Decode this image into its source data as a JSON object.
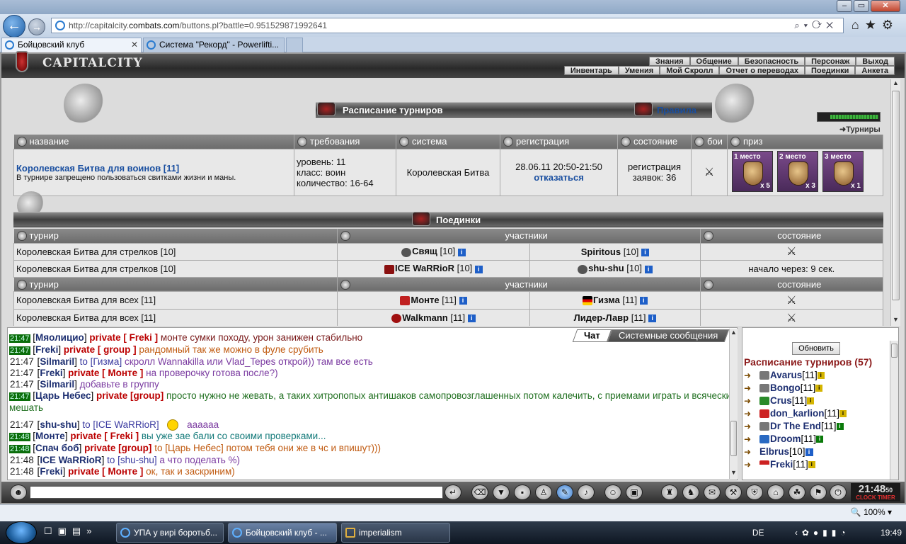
{
  "browser": {
    "url_prefix": "http://capitalcity.",
    "url_domain": "combats.com",
    "url_rest": "/buttons.pl?battle=0.951529871992641",
    "tabs": [
      {
        "label": "Бойцовский клуб"
      },
      {
        "label": "Система \"Рекорд\" - Powerlifti..."
      }
    ],
    "zoom": "100%"
  },
  "game": {
    "logo": "CAPITALCITY",
    "menu_row1": [
      "Знания",
      "Общение",
      "Безопасность",
      "Персонаж",
      "Выход"
    ],
    "menu_row2": [
      "Инвентарь",
      "Умения",
      "Мой Скролл",
      "Отчет о переводах",
      "Поединки",
      "Анкета"
    ],
    "turniry_link": "Турниры",
    "schedule": {
      "title": "Расписание турниров",
      "rules_link": "Правила",
      "headers": [
        "название",
        "требования",
        "система",
        "регистрация",
        "состояние",
        "бои",
        "приз"
      ],
      "row": {
        "name": "Королевская Битва для воинов [11]",
        "note": "В турнире запрещено пользоваться свитками жизни и маны.",
        "req_level": "уровень: 11",
        "req_class": "класс: воин",
        "req_count": "количество: 16-64",
        "system": "Королевская Битва",
        "reg_time": "28.06.11 20:50-21:50",
        "reg_cancel": "отказаться",
        "state_line1": "регистрация",
        "state_line2": "заявок: 36",
        "prizes": [
          {
            "place": "1 место",
            "qty": "x 5"
          },
          {
            "place": "2 место",
            "qty": "x 3"
          },
          {
            "place": "3 место",
            "qty": "x 1"
          }
        ]
      }
    },
    "fights": {
      "title": "Поединки",
      "header_tour": "турнир",
      "header_participants": "участники",
      "header_state": "состояние",
      "group1": [
        {
          "tour": "Королевская Битва для стрелков [10]",
          "p1": "Свящ",
          "p1lvl": " [10]",
          "p2": "Spiritous",
          "p2lvl": " [10]",
          "state": ""
        },
        {
          "tour": "Королевская Битва для стрелков [10]",
          "p1": "ICE WaRRioR",
          "p1lvl": " [10]",
          "p2": "shu-shu",
          "p2lvl": " [10]",
          "state": "начало через: 9 сек."
        }
      ],
      "group2": [
        {
          "tour": "Королевская Битва для всех [11]",
          "p1": "Монте",
          "p1lvl": " [11]",
          "p2": "Гизма",
          "p2lvl": " [11]",
          "state": ""
        },
        {
          "tour": "Королевская Битва для всех [11]",
          "p1": "Walkmann",
          "p1lvl": " [11]",
          "p2": "Лидер-Лавр",
          "p2lvl": " [11]",
          "state": ""
        }
      ]
    },
    "chat": {
      "tab_chat": "Чат",
      "tab_system": "Системные сообщения",
      "lines": [
        {
          "time": "21:47",
          "nick": "Мяолицио",
          "priv": "private [ Freki ]",
          "text": "монте сумки походу, урон занижен стабильно"
        },
        {
          "time": "21:47",
          "nick": "Freki",
          "priv": "private [ group ]",
          "text": "рандомный так же можно в фуле срубить"
        },
        {
          "time": "21:47",
          "nick": "Silmaril",
          "priv": "",
          "to": "to [Гизма]",
          "text": "скролл Wannakilla или Vlad_Tepes открой)) там все есть"
        },
        {
          "time": "21:47",
          "nick": "Freki",
          "priv": "private [ Монте ]",
          "text": "на проверочку готова после?)"
        },
        {
          "time": "21:47",
          "nick": "Silmaril",
          "priv": "",
          "text": "добавьте в группу"
        },
        {
          "time": "21:47",
          "nick": "Царь Небес",
          "priv": "private [group]",
          "text": "просто нужно не жевать, а таких хитропопых антишаков самопровозглашенных потом калечить, с приемами играть и всячески мешать"
        },
        {
          "time": "21:47",
          "nick": "shu-shu",
          "priv": "",
          "to": "to [ICE WaRRioR]",
          "text": "аааааа"
        },
        {
          "time": "21:48",
          "nick": "Монте",
          "priv": "private [ Freki ]",
          "text": "вы уже зае бали со своими проверками..."
        },
        {
          "time": "21:48",
          "nick": "Спач боб",
          "priv": "private [group]",
          "text": "to [Царь Небес] потом тебя они же в чс и впишут)))"
        },
        {
          "time": "21:48",
          "nick": "ICE WaRRioR",
          "priv": "",
          "to": "to [shu-shu]",
          "text": "а что поделать %)"
        },
        {
          "time": "21:48",
          "nick": "Freki",
          "priv": "private [ Монте ]",
          "text": "ок, так и заскриним)"
        }
      ]
    },
    "sidebar": {
      "refresh": "Обновить",
      "title": "Расписание турниров (57)",
      "players": [
        {
          "name": "Avarus",
          "lvl": "[11]"
        },
        {
          "name": "Bongo",
          "lvl": "[11]"
        },
        {
          "name": "Crus",
          "lvl": "[11]"
        },
        {
          "name": "don_karlion",
          "lvl": "[11]"
        },
        {
          "name": "Dr The End",
          "lvl": "[11]"
        },
        {
          "name": "Droom",
          "lvl": "[11]"
        },
        {
          "name": "Elbrus",
          "lvl": "[10]"
        },
        {
          "name": "Freki",
          "lvl": "[11]"
        }
      ]
    },
    "clock": {
      "time": "21:48",
      "sec": "50",
      "label1": "CLOCK",
      "label2": "TIMER"
    }
  },
  "taskbar": {
    "items": [
      {
        "label": "УПА у вирі боротьб..."
      },
      {
        "label": "Бойцовский клуб - ..."
      },
      {
        "label": "imperialism"
      }
    ],
    "lang": "DE",
    "time": "19:49"
  }
}
